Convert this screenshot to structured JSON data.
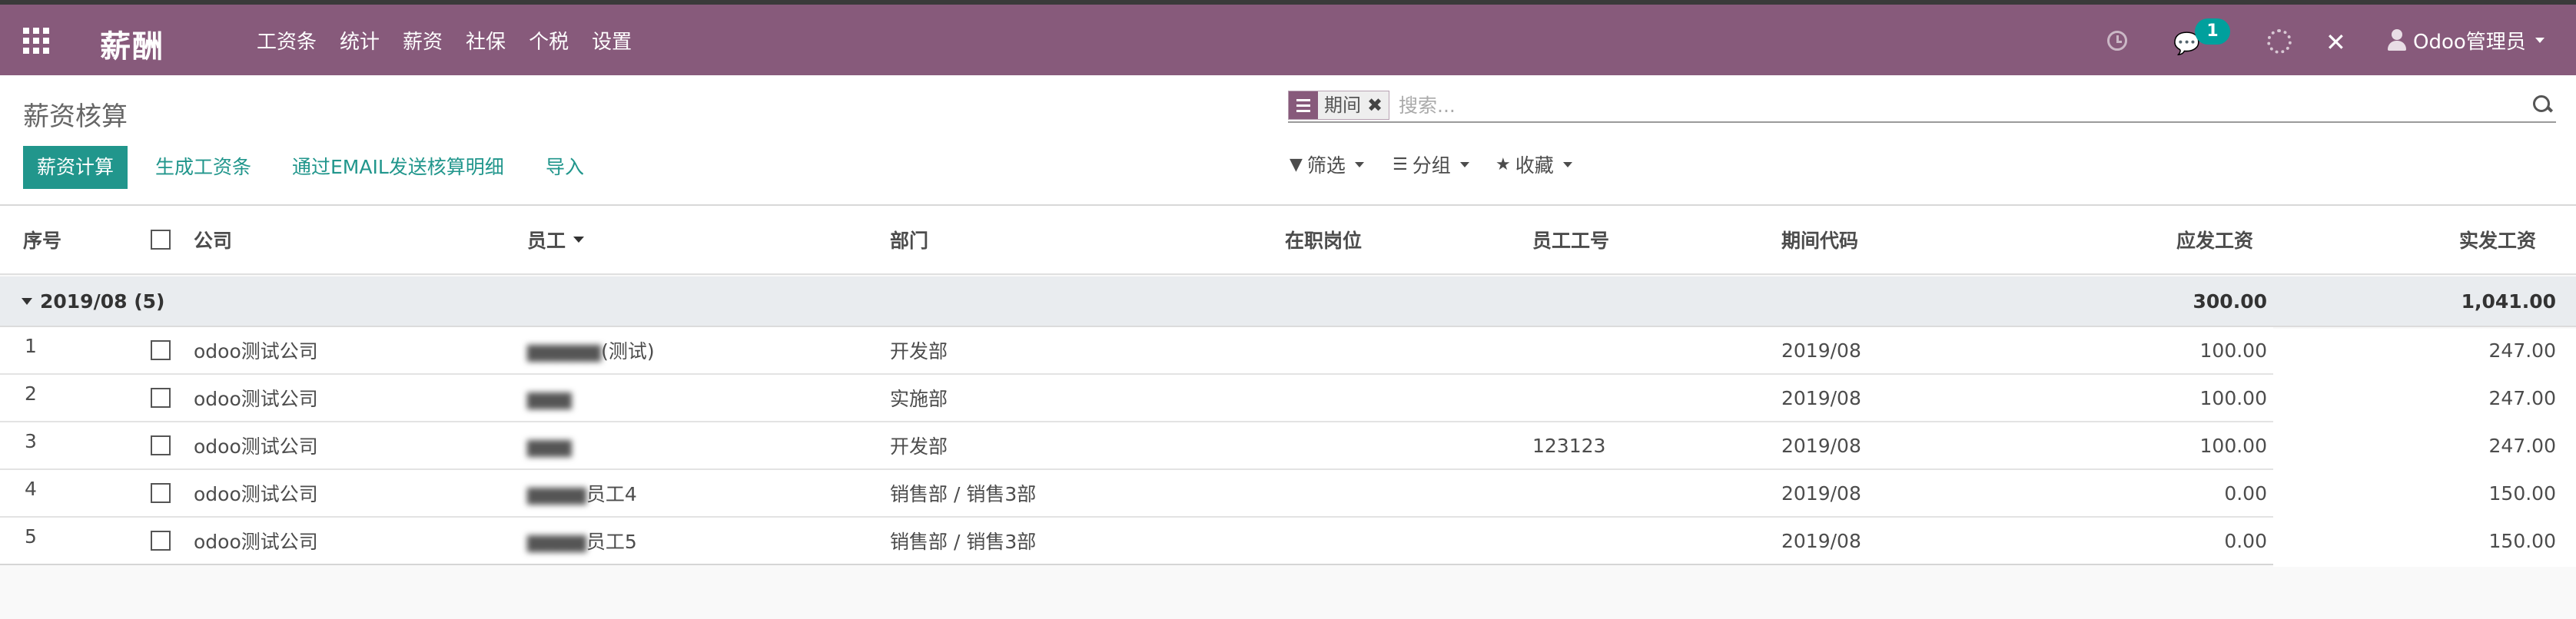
{
  "navbar": {
    "brand": "薪酬",
    "menu": [
      "工资条",
      "统计",
      "薪资",
      "社保",
      "个税",
      "设置"
    ],
    "chat_badge": "1",
    "user_label": "Odoo管理员"
  },
  "control_panel": {
    "breadcrumb": "薪资核算",
    "buttons": {
      "payroll_calc": "薪资计算",
      "generate_payslip": "生成工资条",
      "email_details": "通过EMAIL发送核算明细",
      "import": "导入"
    },
    "search": {
      "facet_label": "期间",
      "facet_remove": "✖",
      "placeholder": "搜索..."
    },
    "filters": {
      "filter_label": "筛选",
      "group_label": "分组",
      "favorites_label": "收藏"
    }
  },
  "table": {
    "columns": {
      "index": "序号",
      "company": "公司",
      "employee": "员工",
      "department": "部门",
      "position": "在职岗位",
      "employee_no": "员工工号",
      "period_code": "期间代码",
      "gross_pay": "应发工资",
      "net_pay": "实发工资"
    },
    "group": {
      "label": "2019/08 (5)",
      "gross_total": "300.00",
      "net_total": "1,041.00"
    },
    "rows": [
      {
        "index": "1",
        "company": "odoo测试公司",
        "employee_masked": "▆▆▆▆▆",
        "employee_suffix": "(测试)",
        "department": "开发部",
        "position": "",
        "employee_no": "",
        "period_code": "2019/08",
        "gross": "100.00",
        "net": "247.00"
      },
      {
        "index": "2",
        "company": "odoo测试公司",
        "employee_masked": "▆▆▆",
        "employee_suffix": "",
        "department": "实施部",
        "position": "",
        "employee_no": "",
        "period_code": "2019/08",
        "gross": "100.00",
        "net": "247.00"
      },
      {
        "index": "3",
        "company": "odoo测试公司",
        "employee_masked": "▆▆▆",
        "employee_suffix": "",
        "department": "开发部",
        "position": "",
        "employee_no": "123123",
        "period_code": "2019/08",
        "gross": "100.00",
        "net": "247.00"
      },
      {
        "index": "4",
        "company": "odoo测试公司",
        "employee_masked": "▆▆▆▆",
        "employee_suffix": "员工4",
        "department": "销售部 / 销售3部",
        "position": "",
        "employee_no": "",
        "period_code": "2019/08",
        "gross": "0.00",
        "net": "150.00"
      },
      {
        "index": "5",
        "company": "odoo测试公司",
        "employee_masked": "▆▆▆▆",
        "employee_suffix": "员工5",
        "department": "销售部 / 销售3部",
        "position": "",
        "employee_no": "",
        "period_code": "2019/08",
        "gross": "0.00",
        "net": "150.00"
      }
    ]
  },
  "colors": {
    "navbar": "#875a7b",
    "primary": "#21968c",
    "badge": "#00a09d"
  }
}
